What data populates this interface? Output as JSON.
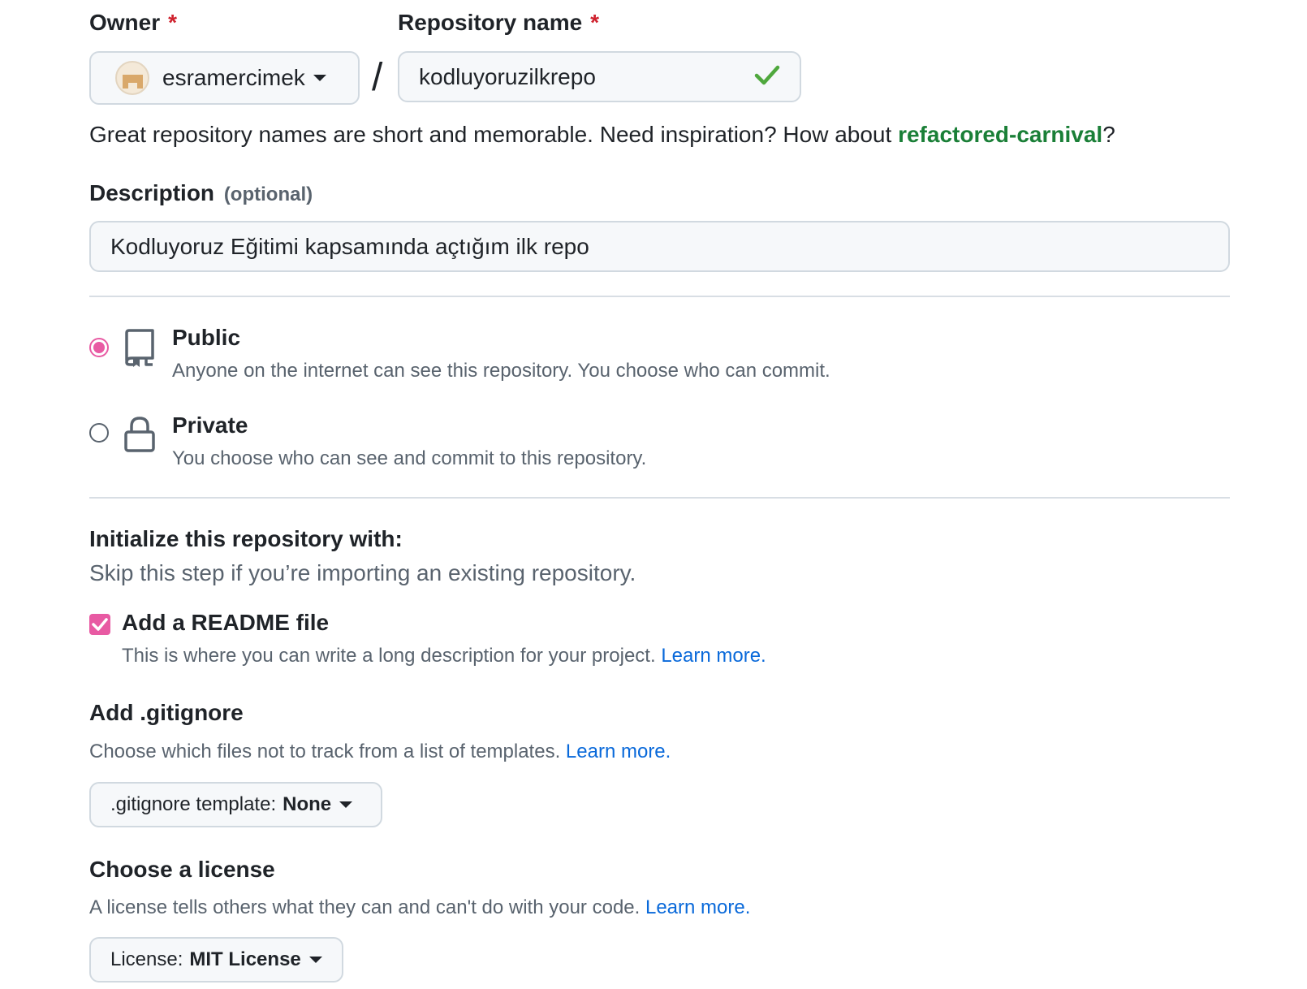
{
  "owner": {
    "label": "Owner",
    "required_mark": "*",
    "value": "esramercimek"
  },
  "separator": "/",
  "repository": {
    "label": "Repository name",
    "required_mark": "*",
    "value": "kodluyoruzilkrepo",
    "valid_icon": "check-icon"
  },
  "name_hint": {
    "prefix": "Great repository names are short and memorable. Need inspiration? How about ",
    "suggestion": "refactored-carnival",
    "suffix": "?"
  },
  "description": {
    "label": "Description",
    "optional": "(optional)",
    "value": "Kodluyoruz Eğitimi kapsamında açtığım ilk repo"
  },
  "visibility": {
    "options": [
      {
        "title": "Public",
        "description": "Anyone on the internet can see this repository. You choose who can commit.",
        "icon": "repo-icon",
        "selected": true
      },
      {
        "title": "Private",
        "description": "You choose who can see and commit to this repository.",
        "icon": "lock-icon",
        "selected": false
      }
    ]
  },
  "initialize": {
    "title": "Initialize this repository with:",
    "subtitle": "Skip this step if you’re importing an existing repository.",
    "readme": {
      "label": "Add a README file",
      "description": "This is where you can write a long description for your project.",
      "link": "Learn more.",
      "checked": true
    }
  },
  "gitignore": {
    "title": "Add .gitignore",
    "description": "Choose which files not to track from a list of templates.",
    "link": "Learn more.",
    "select_prefix": ".gitignore template:",
    "select_value": "None"
  },
  "license": {
    "title": "Choose a license",
    "description": "A license tells others what they can and can't do with your code.",
    "link": "Learn more.",
    "select_prefix": "License:",
    "select_value": "MIT License"
  },
  "colors": {
    "accent_pink": "#e85aa3",
    "link_blue": "#0969da",
    "success_green": "#1a7f37",
    "required_red": "#cf222e"
  }
}
